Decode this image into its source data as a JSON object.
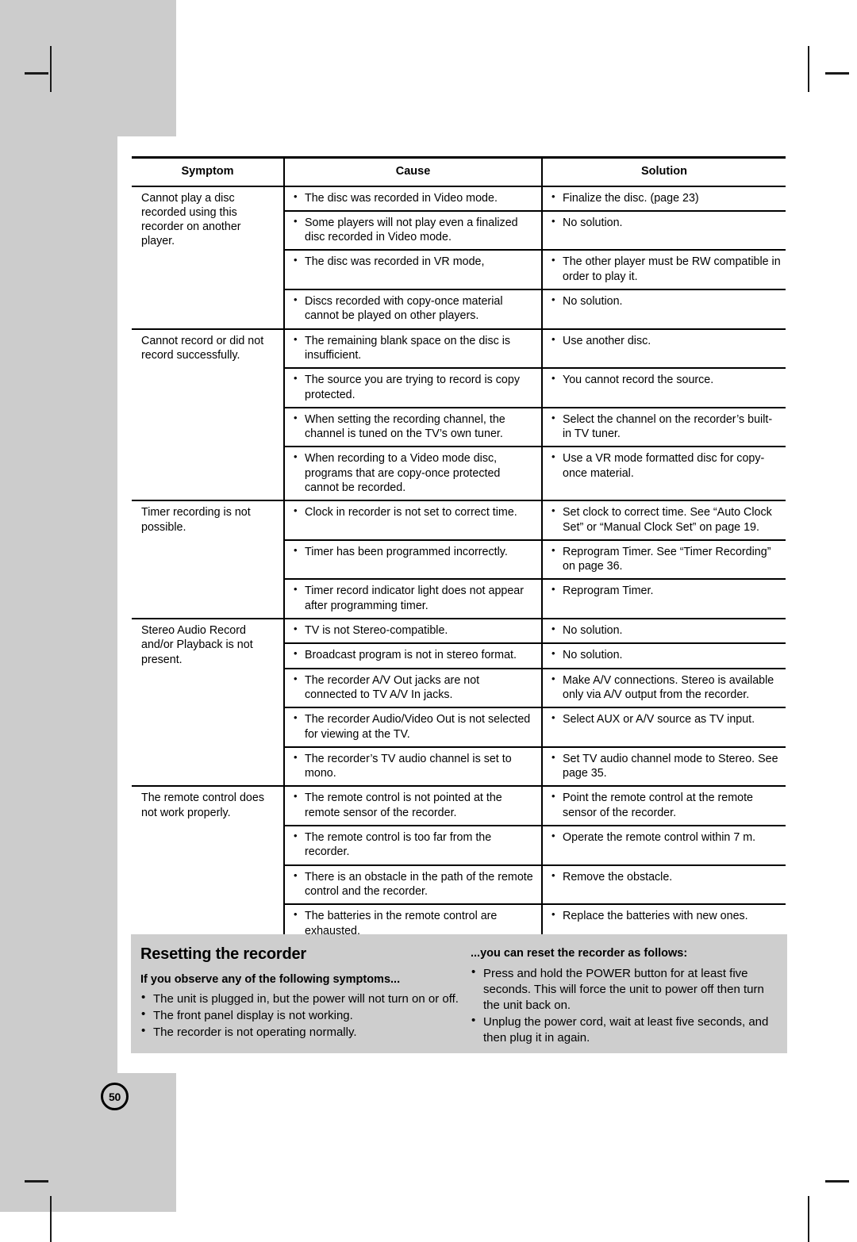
{
  "page": {
    "number": "50"
  },
  "table": {
    "headers": {
      "symptom": "Symptom",
      "cause": "Cause",
      "solution": "Solution"
    },
    "groups": [
      {
        "symptom": "Cannot play a disc recorded using this recorder on another player.",
        "rows": [
          {
            "cause": [
              "The disc was recorded in Video mode."
            ],
            "solution": [
              "Finalize the disc. (page 23)"
            ]
          },
          {
            "cause": [
              "Some players will not play even a finalized disc recorded in Video mode."
            ],
            "solution": [
              "No solution."
            ]
          },
          {
            "cause": [
              "The disc was recorded in VR mode,"
            ],
            "solution": [
              "The other player must be RW compatible in order to play it."
            ]
          },
          {
            "cause": [
              "Discs recorded with copy-once material cannot be played on other players."
            ],
            "solution": [
              "No solution."
            ]
          }
        ]
      },
      {
        "symptom": "Cannot record or did not record successfully.",
        "rows": [
          {
            "cause": [
              "The remaining blank space on the disc is insufficient."
            ],
            "solution": [
              "Use another disc."
            ]
          },
          {
            "cause": [
              "The source you are trying to record is copy protected."
            ],
            "solution": [
              "You cannot record the source."
            ]
          },
          {
            "cause": [
              "When setting the recording channel, the channel is tuned on the TV’s own tuner."
            ],
            "solution": [
              "Select the channel on the recorder’s built-in TV tuner."
            ]
          },
          {
            "cause": [
              "When recording to a Video mode disc, programs that are copy-once protected cannot be recorded."
            ],
            "solution": [
              "Use a VR mode formatted disc for copy-once material."
            ]
          }
        ]
      },
      {
        "symptom": "Timer recording is not possible.",
        "rows": [
          {
            "cause": [
              "Clock in recorder is not set to correct time."
            ],
            "solution": [
              "Set clock to correct time. See “Auto Clock Set” or “Manual Clock Set” on page 19."
            ]
          },
          {
            "cause": [
              "Timer has been programmed incorrectly."
            ],
            "solution": [
              "Reprogram Timer. See “Timer Recording” on page 36."
            ]
          },
          {
            "cause": [
              "Timer record indicator light does not appear after programming timer."
            ],
            "solution": [
              "Reprogram Timer."
            ]
          }
        ]
      },
      {
        "symptom": "Stereo Audio Record and/or Playback is not present.",
        "rows": [
          {
            "cause": [
              "TV is not Stereo-compatible."
            ],
            "solution": [
              "No solution."
            ]
          },
          {
            "cause": [
              "Broadcast program is not in stereo format."
            ],
            "solution": [
              "No solution."
            ]
          },
          {
            "cause": [
              "The recorder A/V Out jacks are not connected to TV A/V In jacks."
            ],
            "solution": [
              "Make A/V connections. Stereo is available only via A/V output from the recorder."
            ]
          },
          {
            "cause": [
              "The recorder Audio/Video Out is not selected for viewing at the TV."
            ],
            "solution": [
              "Select AUX or A/V source as TV input."
            ]
          },
          {
            "cause": [
              "The recorder’s TV audio channel is set to mono."
            ],
            "solution": [
              "Set TV audio channel mode to Stereo. See page 35."
            ]
          }
        ]
      },
      {
        "symptom": "The remote control does not work properly.",
        "rows": [
          {
            "cause": [
              "The remote control is not pointed at the remote sensor of the recorder."
            ],
            "solution": [
              "Point the remote control at the remote sensor of the recorder."
            ]
          },
          {
            "cause": [
              "The remote control is too far from the recorder."
            ],
            "solution": [
              "Operate the remote control within 7 m."
            ]
          },
          {
            "cause": [
              "There is an obstacle in the path of the remote control and the recorder."
            ],
            "solution": [
              "Remove the obstacle."
            ]
          },
          {
            "cause": [
              "The batteries in the remote control are exhausted."
            ],
            "solution": [
              "Replace the batteries with new ones."
            ]
          }
        ]
      }
    ]
  },
  "reset_section": {
    "title": "Resetting the recorder",
    "left_subtitle": "If you observe any of the following symptoms...",
    "left_items": [
      "The unit is plugged in, but the power will not turn on or off.",
      "The front panel display is not working.",
      "The recorder is not operating normally."
    ],
    "right_subtitle": "...you can reset the recorder as follows:",
    "right_items": [
      "Press and hold the POWER button for at least five seconds. This will force the unit to power off then turn the unit back on.",
      "Unplug the power cord, wait at least five seconds, and then plug it in again."
    ]
  }
}
